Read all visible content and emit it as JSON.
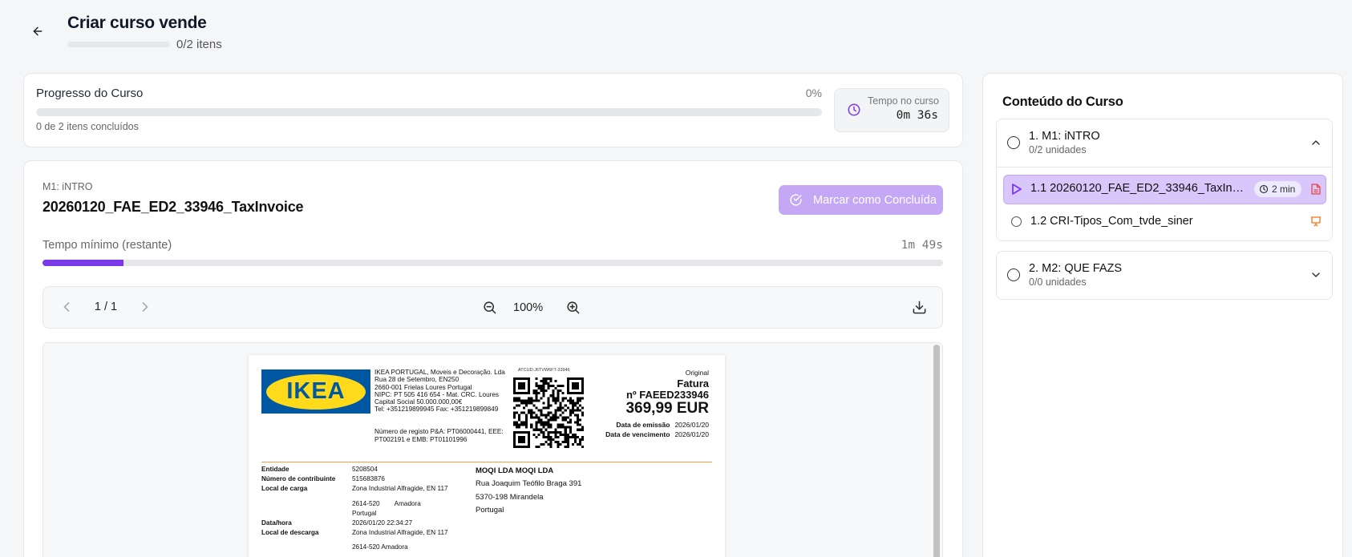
{
  "header": {
    "title": "Criar curso vende",
    "progress_fraction": 0,
    "item_count": "0/2 itens"
  },
  "progress_card": {
    "title": "Progresso do Curso",
    "percent": "0%",
    "percent_value": 0,
    "completed_text": "0 de 2 itens concluídos",
    "time_label": "Tempo no curso",
    "time_value": "0m 36s"
  },
  "lesson": {
    "module": "M1: iNTRO",
    "title": "20260120_FAE_ED2_33946_TaxInvoice",
    "mark_button": "Marcar como Concluída",
    "min_time_label": "Tempo mínimo (restante)",
    "min_time_value": "1m 49s",
    "min_time_progress": 0.09
  },
  "viewer": {
    "page_indicator": "1 / 1",
    "zoom": "100%"
  },
  "invoice": {
    "company_lines": [
      "IKEA PORTUGAL, Moveis e Decoração. Lda",
      "Rua 28 de Setembro, EN250",
      "2660-001 Frielas Loures Portugal",
      "NIPC: PT 505 416 654 - Mat. CRC. Loures",
      "Capital Social 50.000.000,00€",
      "Tel: +351219899945 Fax: +351219899849"
    ],
    "registration_lines": [
      "Número de registo P&A: PT06000441, EEE:",
      "PT002191 e EMB: PT01101996"
    ],
    "logo_text": "IKEA",
    "atcud": "ATCUD:J6TVW6FT-33946",
    "original": "Original",
    "doc_type": "Fatura",
    "doc_number": "nº FAEED233946",
    "total": "369,99 EUR",
    "emission_label": "Data de emissão",
    "emission_date": "2026/01/20",
    "due_label": "Data de vencimento",
    "due_date": "2026/01/20",
    "fields": {
      "entity_label": "Entidade",
      "entity_value": "5208504",
      "taxpayer_label": "Número de contribuinte",
      "taxpayer_value": "515683876",
      "loading_label": "Local de carga",
      "loading_value": "Zona Industrial Alfragide, EN 117",
      "postal_code": "2614-520",
      "city": "Amadora",
      "country": "Portugal",
      "datetime_label": "Data/hora",
      "datetime_value": "2026/01/20 22:34:27",
      "unloading_label": "Local de descarga",
      "unloading_value": "Zona Industrial Alfragide, EN 117",
      "unloading_postal": "2614-520 Amadora"
    },
    "customer_lines": [
      "MOQI LDA MOQI LDA",
      "Rua Joaquim Teófilo Braga 391",
      "5370-198 Mirandela",
      "Portugal"
    ]
  },
  "sidebar": {
    "title": "Conteúdo do Curso",
    "modules": [
      {
        "title": "1. M1: iNTRO",
        "subtitle": "0/2 unidades",
        "lessons": [
          {
            "label": "1.1 20260120_FAE_ED2_33946_TaxInvoice",
            "duration": "2 min",
            "icon": "file-pdf-icon"
          },
          {
            "label": "1.2 CRI-Tipos_Com_tvde_siner",
            "icon": "presentation-icon"
          }
        ]
      },
      {
        "title": "2. M2: QUE FAZS",
        "subtitle": "0/0 unidades"
      }
    ]
  },
  "colors": {
    "accent": "#7c3aed",
    "accent_light": "#c4a8f5",
    "active_row": "#d9c6fa",
    "pdf_red": "#ef4444",
    "slides_orange": "#f97316",
    "background": "#f5f6f8"
  }
}
